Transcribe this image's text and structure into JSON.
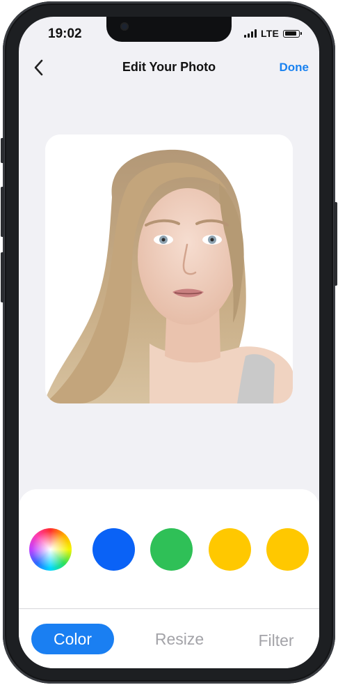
{
  "status_bar": {
    "time": "19:02",
    "network": "LTE",
    "icons": [
      "signal-icon",
      "battery-icon"
    ]
  },
  "nav": {
    "back_icon": "chevron-left-icon",
    "title": "Edit Your Photo",
    "done_label": "Done"
  },
  "photo": {
    "subject": "portrait-photo"
  },
  "color_options": [
    {
      "name": "color-wheel",
      "color": "conic"
    },
    {
      "name": "blue",
      "color": "#0a62f6"
    },
    {
      "name": "green",
      "color": "#2fc057"
    },
    {
      "name": "yellow",
      "color": "#ffc800"
    },
    {
      "name": "yellow-2",
      "color": "#ffc800"
    }
  ],
  "tabs": [
    {
      "label": "Color",
      "active": true
    },
    {
      "label": "Resize",
      "active": false
    },
    {
      "label": "Filter",
      "active": false
    }
  ],
  "colors": {
    "accent": "#1a82f0",
    "tab_active_bg": "#1a7ff2",
    "inactive_text": "#a3a3a8",
    "screen_bg": "#f1f1f5"
  }
}
